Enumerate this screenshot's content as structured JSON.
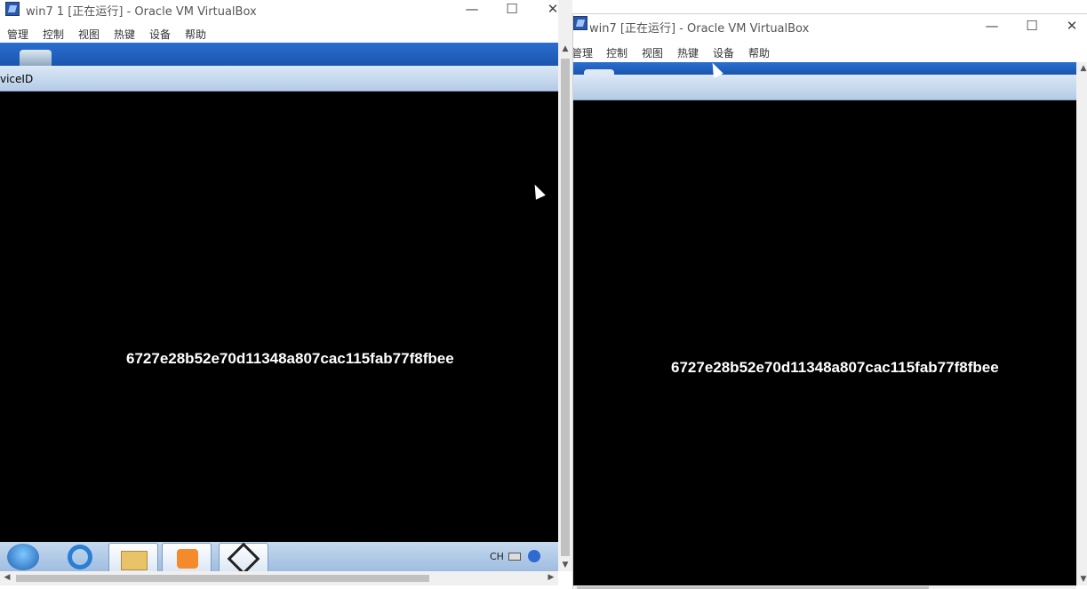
{
  "left_window": {
    "title": "win7 1 [正在运行] - Oracle VM VirtualBox",
    "menu": [
      "管理",
      "控制",
      "视图",
      "热键",
      "设备",
      "帮助"
    ],
    "guest_toolbar_label": "viceID",
    "hash_text": "6727e28b52e70d11348a807cac115fab77f8fbee",
    "tray": {
      "lang": "CH"
    }
  },
  "right_window": {
    "title": "win7 [正在运行] - Oracle VM VirtualBox",
    "menu": [
      "管理",
      "控制",
      "视图",
      "热键",
      "设备",
      "帮助"
    ],
    "hash_text": "6727e28b52e70d11348a807cac115fab77f8fbee"
  },
  "caption_buttons": {
    "minimize": "—",
    "maximize": "☐",
    "close": "✕"
  },
  "colors": {
    "guest_header_blue": "#1e5fbf",
    "guest_subheader": "#c3d7ee",
    "screen": "#000000"
  },
  "icons": [
    "virtualbox-icon",
    "recycle-bin-icon",
    "start-orb-icon",
    "ie-icon",
    "explorer-icon",
    "media-player-icon",
    "unity-icon",
    "keyboard-icon",
    "help-icon"
  ]
}
